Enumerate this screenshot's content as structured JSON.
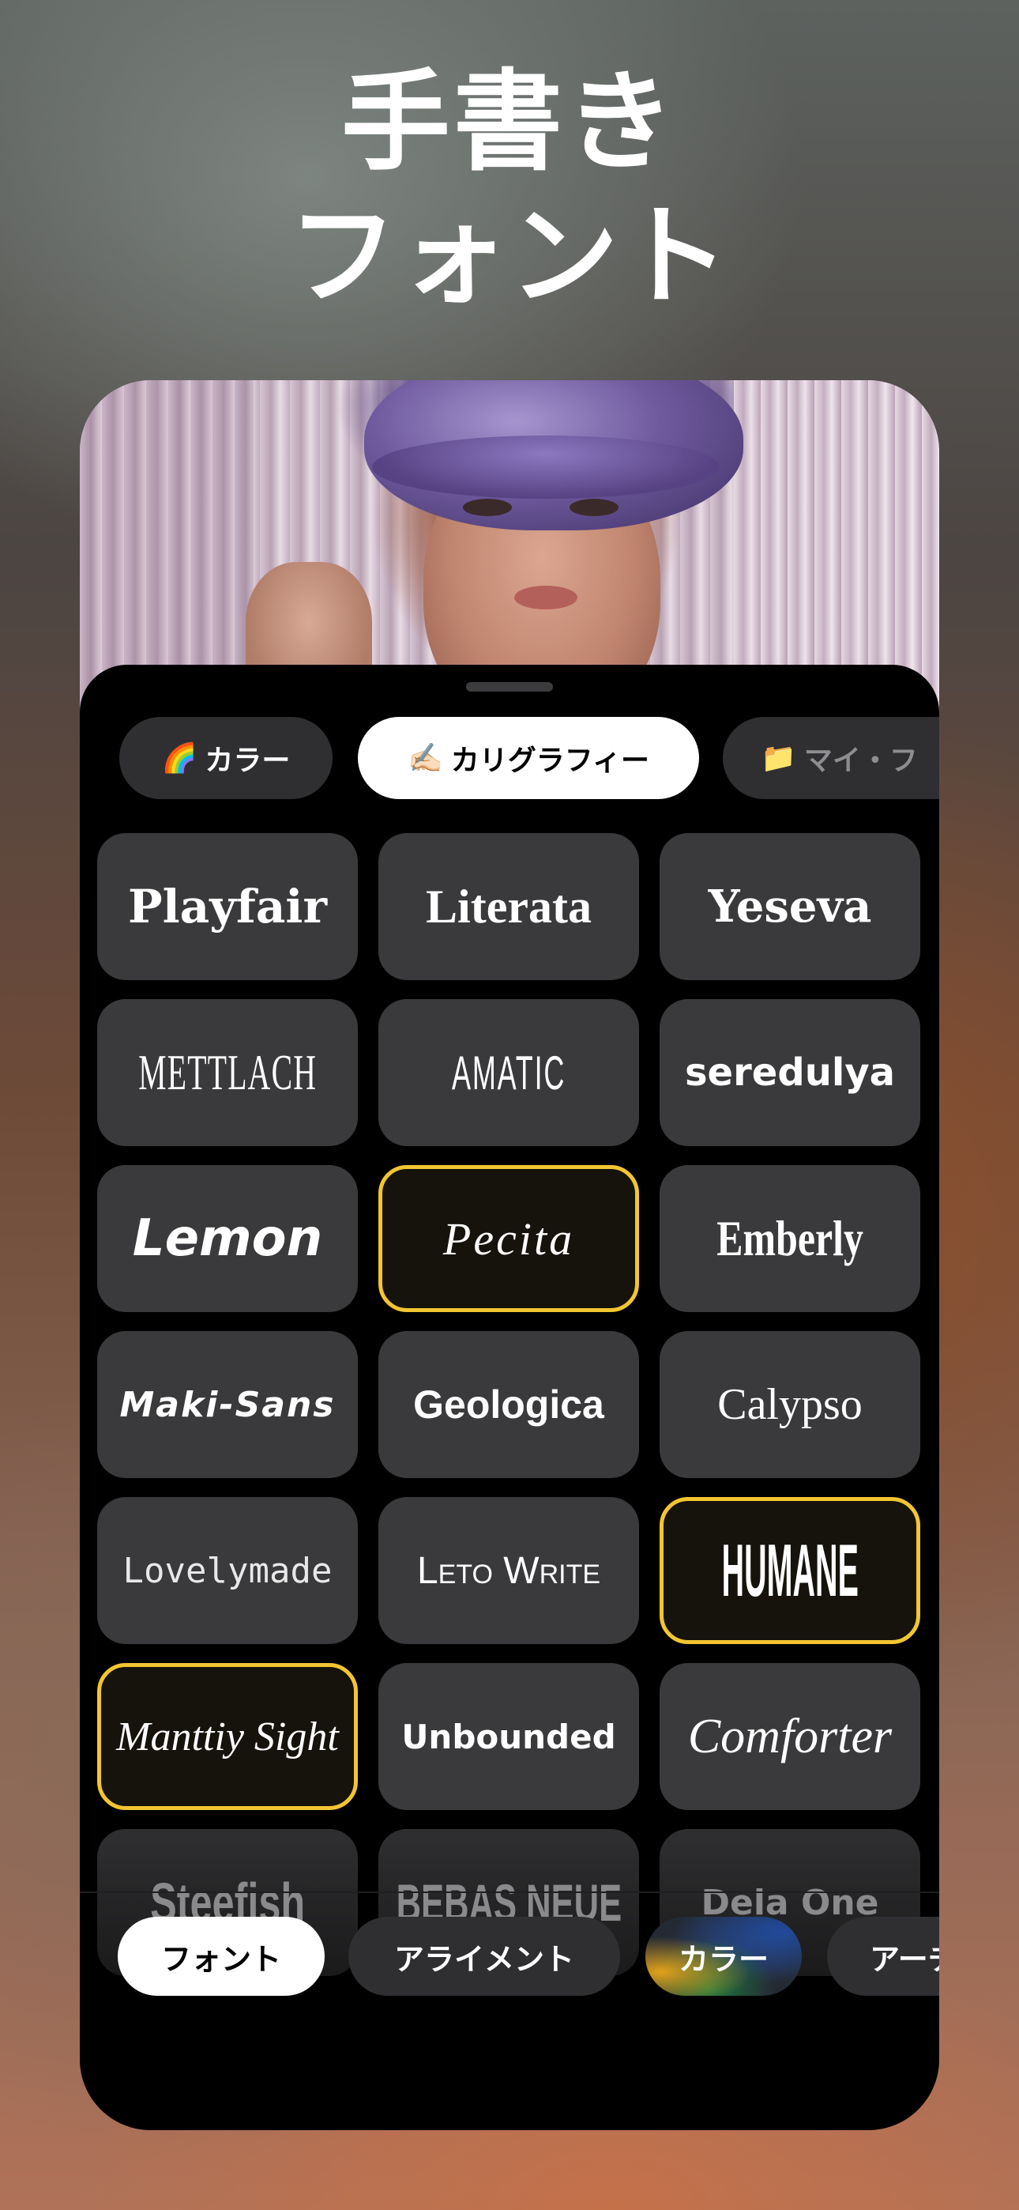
{
  "headline": {
    "line1": "手書き",
    "line2": "フォント"
  },
  "filter_chips": [
    {
      "emoji": "🌈",
      "label": "カラー",
      "state": "default"
    },
    {
      "emoji": "✍🏻",
      "label": "カリグラフィー",
      "state": "active"
    },
    {
      "emoji": "📁",
      "label": "マイ・フ",
      "state": "truncated"
    }
  ],
  "fonts": [
    {
      "label": "Playfair",
      "selected": false
    },
    {
      "label": "Literata",
      "selected": false
    },
    {
      "label": "Yeseva",
      "selected": false
    },
    {
      "label": "METTLACH",
      "selected": false
    },
    {
      "label": "AMATIC",
      "selected": false
    },
    {
      "label": "seredulya",
      "selected": false
    },
    {
      "label": "Lemon",
      "selected": false
    },
    {
      "label": "Pecita",
      "selected": true
    },
    {
      "label": "Emberly",
      "selected": false
    },
    {
      "label": "Maki-Sans",
      "selected": false
    },
    {
      "label": "Geologica",
      "selected": false
    },
    {
      "label": "Calypso",
      "selected": false
    },
    {
      "label": "Lovelymade",
      "selected": false
    },
    {
      "label": "Leto Write",
      "selected": false
    },
    {
      "label": "HUMANE",
      "selected": true
    },
    {
      "label": "Manttiy Sight",
      "selected": true
    },
    {
      "label": "Unbounded",
      "selected": false
    },
    {
      "label": "Comforter",
      "selected": false
    },
    {
      "label": "Steefish",
      "selected": false
    },
    {
      "label": "BEBAS NEUE",
      "selected": false
    },
    {
      "label": "Dela One",
      "selected": false
    }
  ],
  "bottom_tabs": [
    {
      "label": "フォント",
      "state": "active"
    },
    {
      "label": "アライメント",
      "state": "default"
    },
    {
      "label": "カラー",
      "state": "gradient"
    },
    {
      "label": "アーチ",
      "state": "truncated"
    }
  ],
  "colors": {
    "selected_border": "#f2c531",
    "tile_bg": "#3a3a3c",
    "panel_bg": "#000000",
    "active_pill": "#ffffff"
  },
  "icons": [
    "rainbow-emoji-icon",
    "writing-hand-emoji-icon",
    "folder-emoji-icon"
  ]
}
